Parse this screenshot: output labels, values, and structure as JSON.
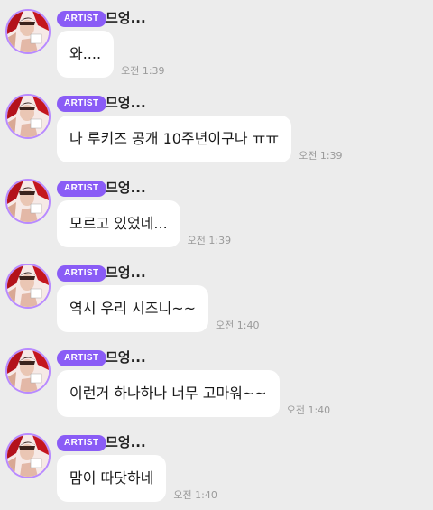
{
  "chat": {
    "messages": [
      {
        "badge": "ARTIST",
        "sender": "므엉...",
        "text": "와....",
        "time": "오전 1:39",
        "avatar_icon": "artist-avatar"
      },
      {
        "badge": "ARTIST",
        "sender": "므엉...",
        "text": "나 루키즈 공개 10주년이구나 ㅠㅠ",
        "time": "오전 1:39",
        "avatar_icon": "artist-avatar"
      },
      {
        "badge": "ARTIST",
        "sender": "므엉...",
        "text": "모르고 있었네...",
        "time": "오전 1:39",
        "avatar_icon": "artist-avatar"
      },
      {
        "badge": "ARTIST",
        "sender": "므엉...",
        "text": "역시 우리 시즈니~~",
        "time": "오전 1:40",
        "avatar_icon": "artist-avatar"
      },
      {
        "badge": "ARTIST",
        "sender": "므엉...",
        "text": "이런거 하나하나 너무 고마워~~",
        "time": "오전 1:40",
        "avatar_icon": "artist-avatar"
      },
      {
        "badge": "ARTIST",
        "sender": "므엉...",
        "text": "맘이 따닷하네",
        "time": "오전 1:40",
        "avatar_icon": "artist-avatar"
      }
    ]
  },
  "colors": {
    "background": "#ececec",
    "badge": "#8a5cf6",
    "avatar_ring": "#b88aff",
    "bubble": "#ffffff",
    "time_text": "#9a9a9a"
  }
}
